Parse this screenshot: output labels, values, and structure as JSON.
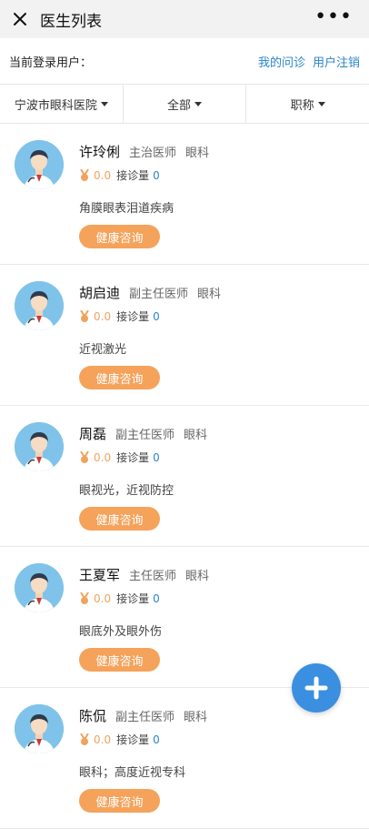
{
  "topbar": {
    "title": "医生列表",
    "more": "•••"
  },
  "user": {
    "label": "当前登录用户：",
    "links": [
      "我的问诊",
      "用户注销"
    ]
  },
  "filters": [
    "宁波市眼科医院",
    "全部",
    "职称"
  ],
  "doctors": [
    {
      "name": "许玲俐",
      "title": "主治医师",
      "dept": "眼科",
      "rating": "0.0",
      "visits_label": "接诊量",
      "visits": "0",
      "specialty": "角膜眼表泪道疾病",
      "button": "健康咨询"
    },
    {
      "name": "胡启迪",
      "title": "副主任医师",
      "dept": "眼科",
      "rating": "0.0",
      "visits_label": "接诊量",
      "visits": "0",
      "specialty": "近视激光",
      "button": "健康咨询"
    },
    {
      "name": "周磊",
      "title": "副主任医师",
      "dept": "眼科",
      "rating": "0.0",
      "visits_label": "接诊量",
      "visits": "0",
      "specialty": "眼视光，近视防控",
      "button": "健康咨询"
    },
    {
      "name": "王夏军",
      "title": "主任医师",
      "dept": "眼科",
      "rating": "0.0",
      "visits_label": "接诊量",
      "visits": "0",
      "specialty": "眼底外及眼外伤",
      "button": "健康咨询"
    },
    {
      "name": "陈侃",
      "title": "副主任医师",
      "dept": "眼科",
      "rating": "0.0",
      "visits_label": "接诊量",
      "visits": "0",
      "specialty": "眼科；高度近视专科",
      "button": "健康咨询"
    }
  ],
  "colors": {
    "accent": "#2a86c9",
    "button": "#f5a25b",
    "fab": "#3b8fe0"
  }
}
